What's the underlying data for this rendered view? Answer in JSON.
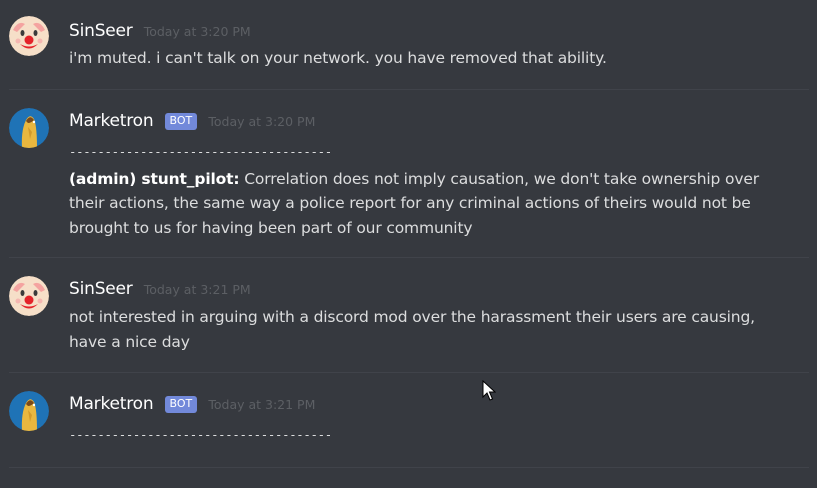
{
  "messages": [
    {
      "author": "SinSeer",
      "avatar": "clown-face-avatar",
      "bot": false,
      "timestamp": "Today at 3:20 PM",
      "text": "i'm muted. i can't talk on your network. you have removed that ability."
    },
    {
      "author": "Marketron",
      "avatar": "gilded-praying-figure-avatar",
      "bot": true,
      "bot_label": "BOT",
      "timestamp": "Today at 3:20 PM",
      "separator": "-------------------------------------",
      "speaker": "(admin) stunt_pilot:",
      "text": " Correlation does not imply causation, we don't take ownership over their actions, the same way a police report for any criminal actions of theirs would not be brought to us for having been part of our community"
    },
    {
      "author": "SinSeer",
      "avatar": "clown-face-avatar",
      "bot": false,
      "timestamp": "Today at 3:21 PM",
      "text": "not interested in arguing with a discord mod over the harassment their users are causing, have a nice day"
    },
    {
      "author": "Marketron",
      "avatar": "gilded-praying-figure-avatar",
      "bot": true,
      "bot_label": "BOT",
      "timestamp": "Today at 3:21 PM",
      "separator": "-------------------------------------"
    }
  ],
  "colors": {
    "background": "#36393f",
    "username": "#ffffff",
    "message_text": "#dcddde",
    "timestamp": "#5c5f64",
    "bot_tag": "#7289da",
    "divider": "#40434a"
  }
}
